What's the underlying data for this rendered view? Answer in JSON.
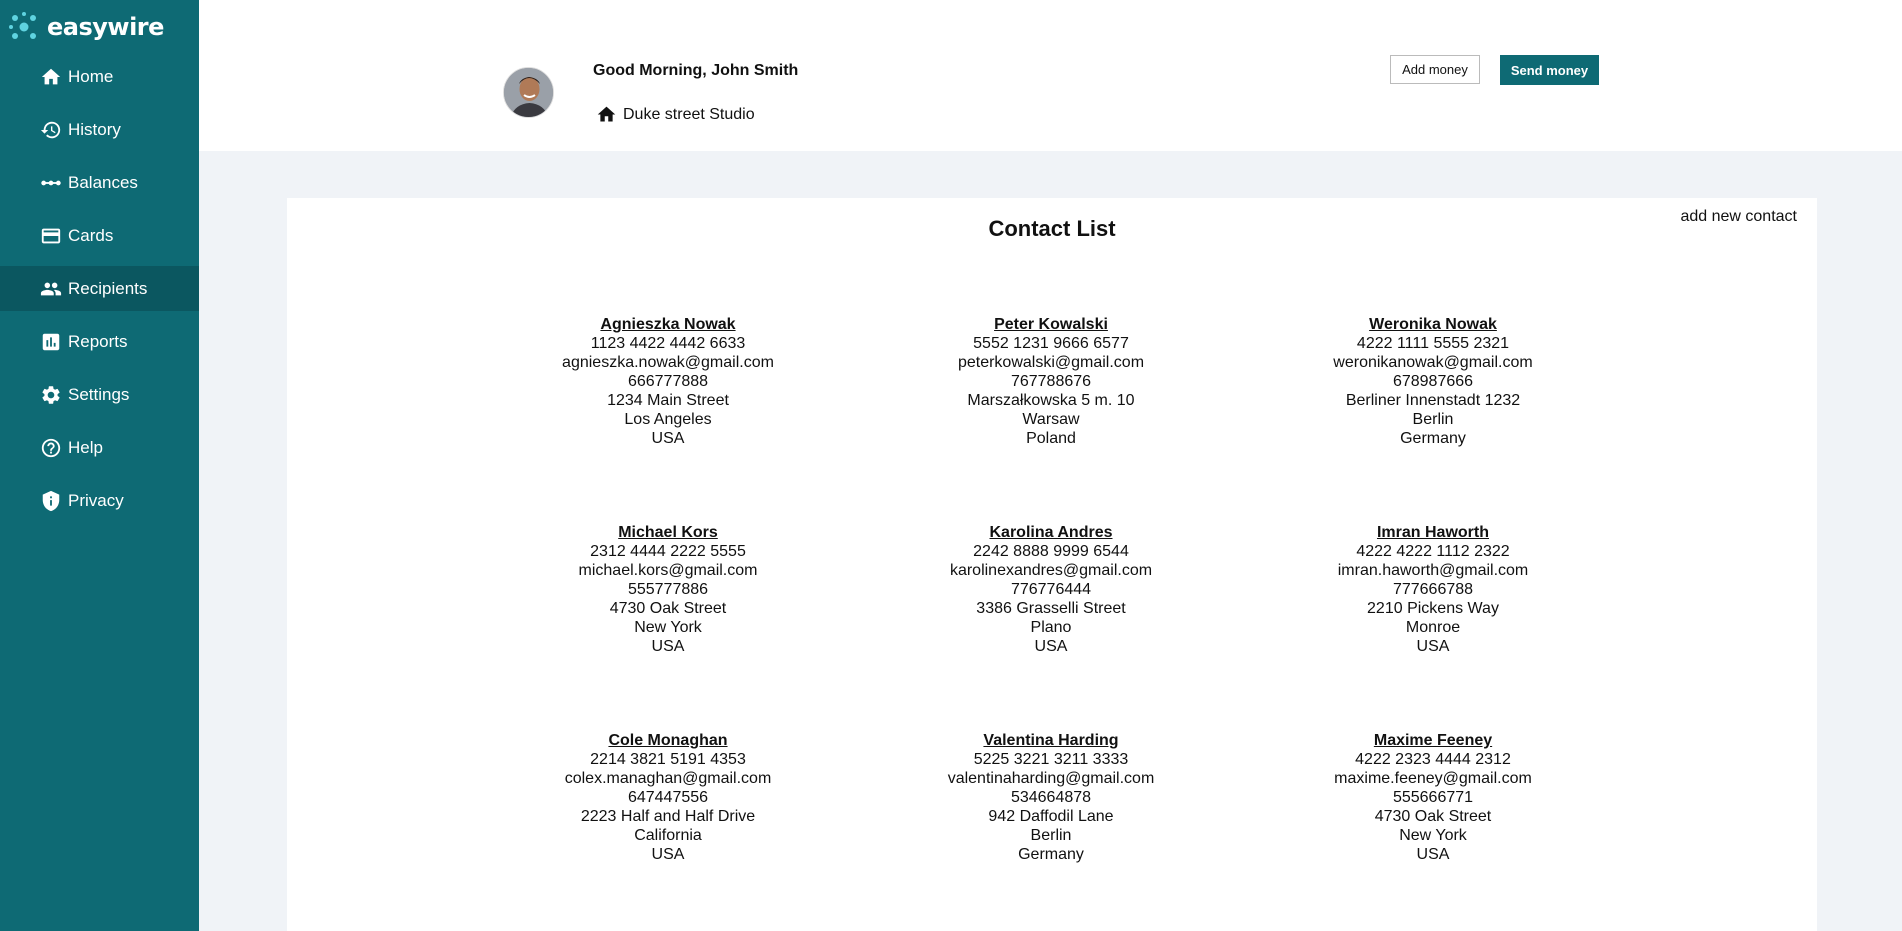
{
  "app": {
    "brand": "easywire"
  },
  "sidebar": {
    "items": [
      {
        "label": "Home",
        "icon": "home-icon"
      },
      {
        "label": "History",
        "icon": "history-icon"
      },
      {
        "label": "Balances",
        "icon": "balances-icon"
      },
      {
        "label": "Cards",
        "icon": "card-icon"
      },
      {
        "label": "Recipients",
        "icon": "people-icon",
        "active": true
      },
      {
        "label": "Reports",
        "icon": "chart-icon"
      },
      {
        "label": "Settings",
        "icon": "gear-icon"
      },
      {
        "label": "Help",
        "icon": "help-icon"
      },
      {
        "label": "Privacy",
        "icon": "shield-icon"
      }
    ]
  },
  "header": {
    "greeting": "Good Morning, John Smith",
    "location": "Duke street Studio",
    "add_money_label": "Add money",
    "send_money_label": "Send money"
  },
  "contacts_section": {
    "title": "Contact List",
    "add_new_label": "add new contact",
    "contacts": [
      {
        "name": "Agnieszka Nowak",
        "card": "1123 4422 4442 6633",
        "email": "agnieszka.nowak@gmail.com",
        "phone": "666777888",
        "street": "1234 Main Street",
        "city": "Los Angeles",
        "country": "USA"
      },
      {
        "name": "Peter Kowalski",
        "card": "5552 1231 9666 6577",
        "email": "peterkowalski@gmail.com",
        "phone": "767788676",
        "street": "Marszałkowska 5 m. 10",
        "city": "Warsaw",
        "country": "Poland"
      },
      {
        "name": "Weronika Nowak",
        "card": "4222 1111 5555 2321",
        "email": "weronikanowak@gmail.com",
        "phone": "678987666",
        "street": "Berliner Innenstadt 1232",
        "city": "Berlin",
        "country": "Germany"
      },
      {
        "name": "Michael Kors",
        "card": "2312 4444 2222 5555",
        "email": "michael.kors@gmail.com",
        "phone": "555777886",
        "street": "4730 Oak Street",
        "city": "New York",
        "country": "USA"
      },
      {
        "name": "Karolina Andres",
        "card": "2242 8888 9999 6544",
        "email": "karolinexandres@gmail.com",
        "phone": "776776444",
        "street": "3386 Grasselli Street",
        "city": "Plano",
        "country": "USA"
      },
      {
        "name": "Imran Haworth",
        "card": "4222 4222 1112 2322",
        "email": "imran.haworth@gmail.com",
        "phone": "777666788",
        "street": "2210 Pickens Way",
        "city": "Monroe",
        "country": "USA"
      },
      {
        "name": "Cole Monaghan",
        "card": "2214 3821 5191 4353",
        "email": "colex.managhan@gmail.com",
        "phone": "647447556",
        "street": "2223 Half and Half Drive",
        "city": "California",
        "country": "USA"
      },
      {
        "name": "Valentina Harding",
        "card": "5225 3221 3211 3333",
        "email": "valentinaharding@gmail.com",
        "phone": "534664878",
        "street": "942 Daffodil Lane",
        "city": "Berlin",
        "country": "Germany"
      },
      {
        "name": "Maxime Feeney",
        "card": "4222 2323 4444 2312",
        "email": "maxime.feeney@gmail.com",
        "phone": "555666771",
        "street": "4730 Oak Street",
        "city": "New York",
        "country": "USA"
      }
    ]
  }
}
